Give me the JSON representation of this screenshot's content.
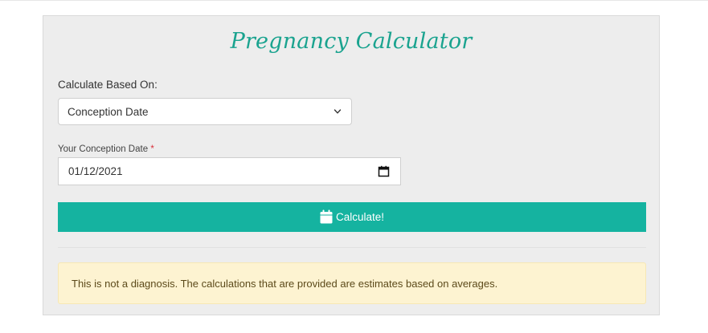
{
  "calculator": {
    "title": "Pregnancy Calculator",
    "based_on_label": "Calculate Based On:",
    "based_on_selected": "Conception Date",
    "date_label": "Your Conception Date",
    "required_marker": "*",
    "date_value": "01/12/2021",
    "calculate_button_label": "Calculate!",
    "disclaimer": "This is not a diagnosis. The calculations that are provided are estimates based on averages."
  },
  "icons": {
    "select_arrow": "chevron-down-icon",
    "date_picker": "calendar-icon",
    "button_icon": "calendar-icon"
  },
  "colors": {
    "accent": "#15b3a0",
    "title": "#1aa38f",
    "card_background": "#ededed",
    "alert_background": "#fdf3d1",
    "required": "#d9303a"
  }
}
